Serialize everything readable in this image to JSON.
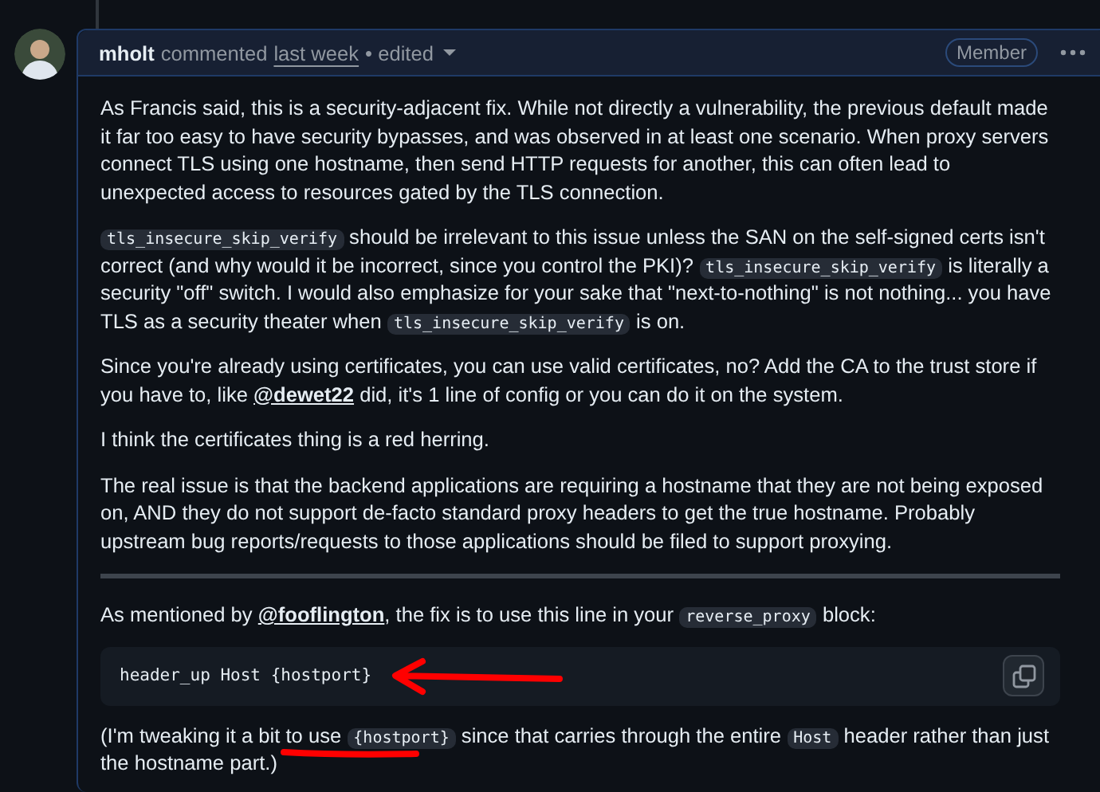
{
  "comment": {
    "author": "mholt",
    "action": "commented",
    "time": "last week",
    "edited": "• edited",
    "badge": "Member",
    "body": [
      {
        "kind": "paragraph",
        "segments": [
          {
            "kind": "text",
            "text": "As Francis said, this is a security-adjacent fix. While not directly a vulnerability, the previous default made it far too easy to have security bypasses, and was observed in at least one scenario. When proxy servers connect TLS using one hostname, then send HTTP requests for another, this can often lead to unexpected access to resources gated by the TLS connection."
          }
        ]
      },
      {
        "kind": "paragraph",
        "segments": [
          {
            "kind": "code",
            "text": "tls_insecure_skip_verify"
          },
          {
            "kind": "text",
            "text": " should be irrelevant to this issue unless the SAN on the self-signed certs isn't correct (and why would it be incorrect, since you control the PKI)? "
          },
          {
            "kind": "code",
            "text": "tls_insecure_skip_verify"
          },
          {
            "kind": "text",
            "text": " is literally a security \"off\" switch. I would also emphasize for your sake that \"next-to-nothing\" is not nothing... you have TLS as a security theater when "
          },
          {
            "kind": "code",
            "text": "tls_insecure_skip_verify"
          },
          {
            "kind": "text",
            "text": " is on."
          }
        ]
      },
      {
        "kind": "paragraph",
        "segments": [
          {
            "kind": "text",
            "text": "Since you're already using certificates, you can use valid certificates, no? Add the CA to the trust store if you have to, like "
          },
          {
            "kind": "mention",
            "text": "@dewet22"
          },
          {
            "kind": "text",
            "text": " did, it's 1 line of config or you can do it on the system."
          }
        ]
      },
      {
        "kind": "paragraph",
        "segments": [
          {
            "kind": "text",
            "text": "I think the certificates thing is a red herring."
          }
        ]
      },
      {
        "kind": "paragraph",
        "segments": [
          {
            "kind": "text",
            "text": "The real issue is that the backend applications are requiring a hostname that they are not being exposed on, AND they do not support de-facto standard proxy headers to get the true hostname. Probably upstream bug reports/requests to those applications should be filed to support proxying."
          }
        ]
      },
      {
        "kind": "rule"
      },
      {
        "kind": "paragraph",
        "segments": [
          {
            "kind": "text",
            "text": "As mentioned by "
          },
          {
            "kind": "mention",
            "text": "@fooflington"
          },
          {
            "kind": "text",
            "text": ", the fix is to use this line in your "
          },
          {
            "kind": "code",
            "text": "reverse_proxy"
          },
          {
            "kind": "text",
            "text": " block:"
          }
        ]
      },
      {
        "kind": "code_block",
        "text": "header_up Host {hostport}",
        "arrow_marked": true
      },
      {
        "kind": "paragraph",
        "underline_marked": true,
        "segments": [
          {
            "kind": "text",
            "text": "(I'm tweaking it a bit to use "
          },
          {
            "kind": "code",
            "text": "{hostport}"
          },
          {
            "kind": "text",
            "text": " since that carries through the entire "
          },
          {
            "kind": "code",
            "text": "Host"
          },
          {
            "kind": "text",
            "text": " header rather than just the hostname part.)"
          }
        ]
      }
    ]
  }
}
